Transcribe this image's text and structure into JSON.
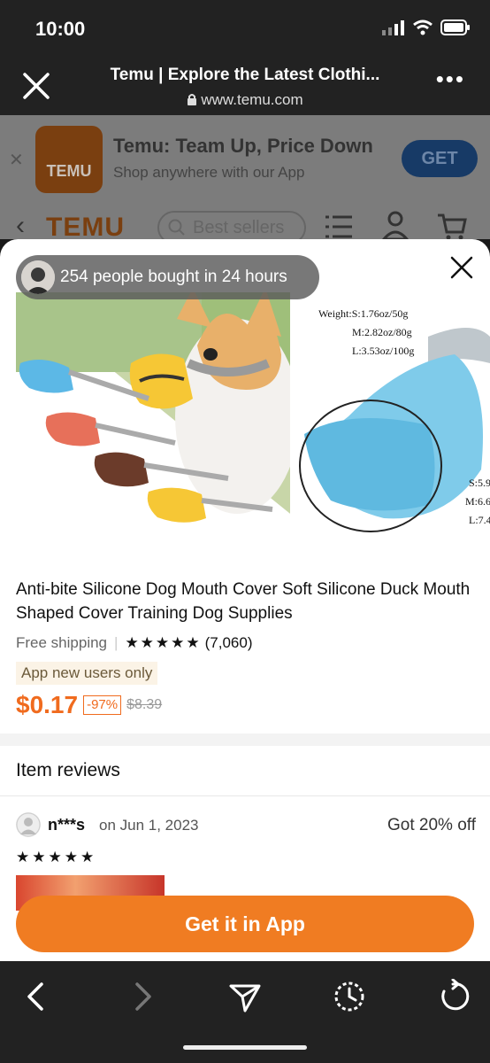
{
  "status_bar": {
    "time": "10:00"
  },
  "browser": {
    "page_title": "Temu | Explore the Latest Clothi...",
    "url": "www.temu.com"
  },
  "app_banner": {
    "logo_text": "TEMU",
    "name": "Temu: Team Up, Price Down",
    "subtitle": "Shop anywhere with our App",
    "get_label": "GET"
  },
  "page_header": {
    "brand": "TEMU",
    "search_placeholder": "Best sellers"
  },
  "product": {
    "social_proof": "254 people bought in 24 hours",
    "image2_labels": [
      "Weight:S:1.76oz/50g",
      "M:2.82oz/80g",
      "L:3.53oz/100g",
      "S:5.9",
      "M:6.6",
      "L:7.4"
    ],
    "title": "Anti-bite Silicone Dog Mouth Cover Soft Silicone Duck Mouth Shaped Cover Training Dog Supplies",
    "shipping": "Free shipping",
    "rating_stars": "★★★★★",
    "rating_count": "(7,060)",
    "badge": "App new users only",
    "price": "$0.17",
    "discount": "-97%",
    "original_price": "$8.39"
  },
  "reviews": {
    "heading": "Item reviews",
    "items": [
      {
        "user": "n***s",
        "date": "on Jun 1, 2023",
        "tag": "Got 20% off",
        "stars": "★★★★★"
      }
    ]
  },
  "cta": {
    "label": "Get it in App"
  },
  "colors": {
    "accent": "#f07c22",
    "price": "#f06b1e",
    "chrome": "#222222"
  }
}
